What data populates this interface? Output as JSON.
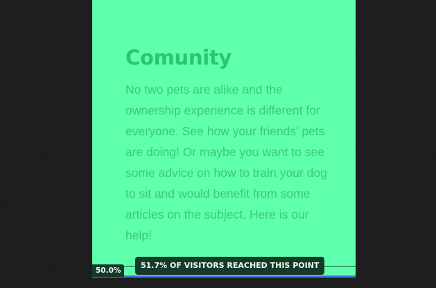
{
  "section": {
    "title": "Comunity",
    "body": "No two pets are alike and the ownership experience is different for everyone. See how your friends' pets are doing! Or maybe you want to see some advice on how to train your dog to sit and would benefit from some articles on the subject. Here is our help!"
  },
  "heatmap": {
    "scroll_percent_label": "50.0%",
    "reach_label": "51.7% OF VISITORS REACHED THIS POINT"
  },
  "colors": {
    "card_background": "#5effad",
    "title": "#2bc472",
    "body_text": "#3cc97c",
    "page_background": "#1e1e1e",
    "overlay": "#17392a"
  }
}
